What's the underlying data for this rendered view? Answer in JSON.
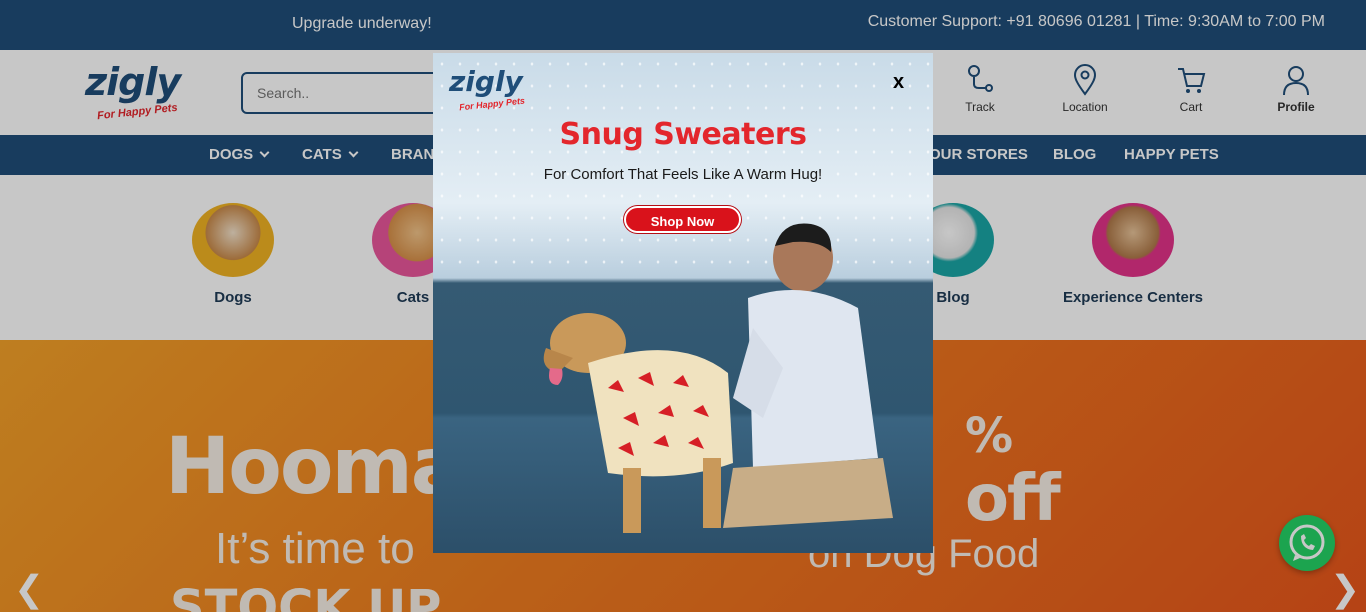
{
  "topbar": {
    "announcement": "Upgrade underway!",
    "support": "Customer Support: +91 80696 01281 | Time: 9:30AM to 7:00 PM"
  },
  "brand": {
    "name": "zigly",
    "tagline": "For Happy Pets"
  },
  "search": {
    "placeholder": "Search.."
  },
  "header_icons": [
    {
      "label": "Track",
      "icon": "track-icon"
    },
    {
      "label": "Location",
      "icon": "location-pin-icon"
    },
    {
      "label": "Cart",
      "icon": "cart-icon"
    },
    {
      "label": "Profile",
      "icon": "profile-icon"
    }
  ],
  "nav": {
    "items": [
      "DOGS",
      "CATS",
      "BRAN",
      "OUR STORES",
      "BLOG",
      "HAPPY PETS"
    ]
  },
  "categories": [
    {
      "label": "Dogs"
    },
    {
      "label": "Cats"
    },
    {
      "label": "Blog"
    },
    {
      "label": "Experience Centers"
    }
  ],
  "hero": {
    "headline": "Hooman",
    "subline": "It’s time to",
    "stock": "STOCK UP",
    "percent": "%",
    "off": "off",
    "product": "on Dog Food",
    "prev": "❮",
    "next": "❯"
  },
  "popup": {
    "brand": "zigly",
    "tagline": "For Happy Pets",
    "close": "x",
    "title": "Snug Sweaters",
    "subtitle": "For Comfort That Feels Like A Warm Hug!",
    "cta": "Shop Now"
  },
  "colors": {
    "navy": "#1f4e79",
    "red": "#e3262c",
    "orange": "#ef7d1f",
    "whatsapp": "#25d366"
  }
}
